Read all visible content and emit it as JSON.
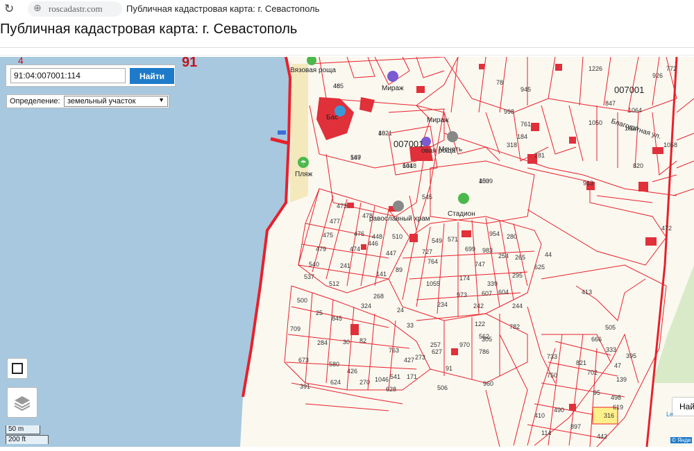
{
  "browser": {
    "url": "roscadastr.com",
    "tab_title": "Публичная кадастровая карта: г. Севастополь"
  },
  "page": {
    "title": "Публичная кадастровая карта: г. Севастополь"
  },
  "search": {
    "value": "91:04:007001:114",
    "button_label": "Найти"
  },
  "definition": {
    "label": "Определение:",
    "selected": "земельный участок"
  },
  "scale": {
    "metric": "50 m",
    "imperial": "200 ft"
  },
  "map": {
    "poi": {
      "beach": "Пляж",
      "grove1": "Вязовая роща",
      "grove2": "овая роща",
      "mirage1": "Мираж",
      "mirage2": "Мираж",
      "pool": "Бас",
      "mosque": "Мечеть",
      "stadium": "Стадион",
      "church": "равославный храм",
      "street": "Благодатная ул."
    },
    "block_labels": [
      "91",
      "4",
      "007001",
      "007001"
    ],
    "parcel_labels": [
      "465",
      "1021",
      "547",
      "1018",
      "450",
      "545",
      "473",
      "477",
      "475",
      "479",
      "540",
      "537",
      "500",
      "25",
      "845",
      "709",
      "284",
      "673",
      "391",
      "624",
      "478",
      "476",
      "474",
      "446",
      "448",
      "510",
      "549",
      "571",
      "727",
      "764",
      "699",
      "983",
      "954",
      "280",
      "254",
      "265",
      "295",
      "625",
      "44",
      "241",
      "512",
      "141",
      "89",
      "447",
      "1055",
      "174",
      "747",
      "339",
      "604",
      "607",
      "244",
      "268",
      "324",
      "24",
      "33",
      "234",
      "973",
      "242",
      "122",
      "782",
      "257",
      "30",
      "82",
      "763",
      "427",
      "273",
      "627",
      "91",
      "970",
      "786",
      "562",
      "305",
      "960",
      "506",
      "580",
      "426",
      "270",
      "1046",
      "541",
      "171",
      "628",
      "847",
      "1226",
      "1050",
      "820",
      "1034",
      "1064",
      "1058",
      "472",
      "772",
      "926",
      "998",
      "761",
      "945",
      "78",
      "318",
      "184",
      "733",
      "750",
      "821",
      "702",
      "95",
      "619",
      "498",
      "139",
      "47",
      "333",
      "505",
      "413",
      "666",
      "395",
      "316",
      "410",
      "490",
      "897",
      "442",
      "114",
      "281",
      "913",
      "48",
      "46",
      "169",
      "644",
      "1039"
    ],
    "colors": {
      "water": "#a7c8df",
      "parcel_line": "#e8202a",
      "building": "#e0303a",
      "land": "#fbf8f0",
      "highlight": "#fff08a"
    }
  },
  "right_button": "Най",
  "attribution": {
    "leaflet": "Le",
    "yandex": "© Янде"
  }
}
